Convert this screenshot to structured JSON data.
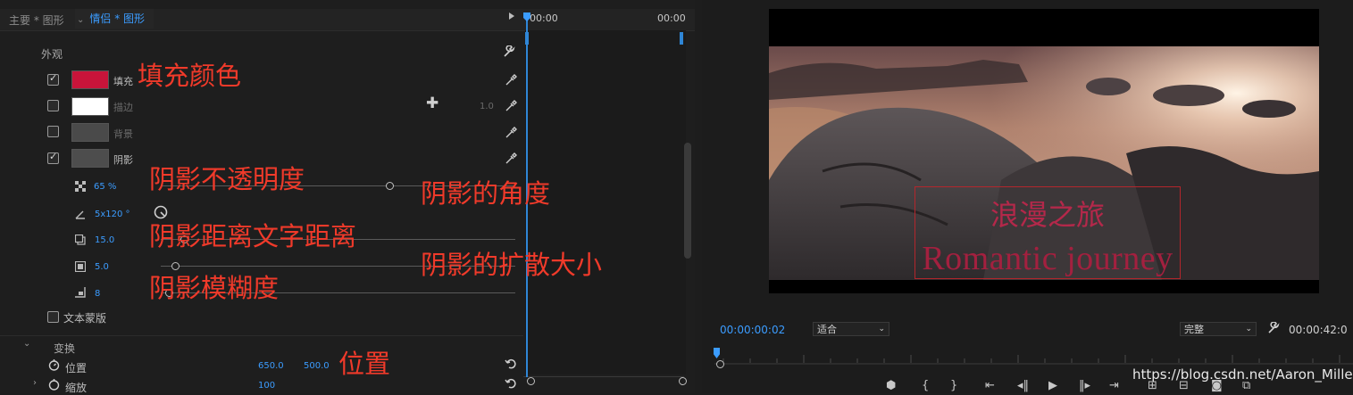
{
  "effects_panel": {
    "tab_main": "主要 * 图形",
    "tab_active": "情侣 * 图形",
    "timeline_start": "00:00",
    "timeline_end": "00:00",
    "section_appearance": "外观",
    "fill": {
      "label": "填充",
      "checked": true,
      "color": "#c8143a"
    },
    "stroke": {
      "label": "描边",
      "checked": false,
      "color": "#ffffff",
      "width": "1.0"
    },
    "background": {
      "label": "背景",
      "checked": false
    },
    "shadow": {
      "label": "阴影",
      "checked": true,
      "opacity": "65 %",
      "angle": "5x120 °",
      "distance": "15.0",
      "size": "5.0",
      "blur": "8"
    },
    "text_mask": {
      "label": "文本蒙版",
      "checked": false
    },
    "section_transform": "变换",
    "position": {
      "label": "位置",
      "x": "650.0",
      "y": "500.0"
    },
    "scale": {
      "label": "缩放",
      "value": "100"
    }
  },
  "annotations": {
    "fill_color": "填充颜色",
    "shadow_opacity": "阴影不透明度",
    "shadow_angle": "阴影的角度",
    "shadow_distance": "阴影距离文字距离",
    "shadow_spread": "阴影的扩散大小",
    "shadow_blur": "阴影模糊度",
    "position": "位置"
  },
  "program_monitor": {
    "title_cn": "浪漫之旅",
    "title_en": "Romantic journey",
    "current_time": "00:00:00:02",
    "zoom": "适合",
    "quality": "完整",
    "duration": "00:00:42:0"
  },
  "watermark": "https://blog.csdn.net/Aaron_Miller"
}
